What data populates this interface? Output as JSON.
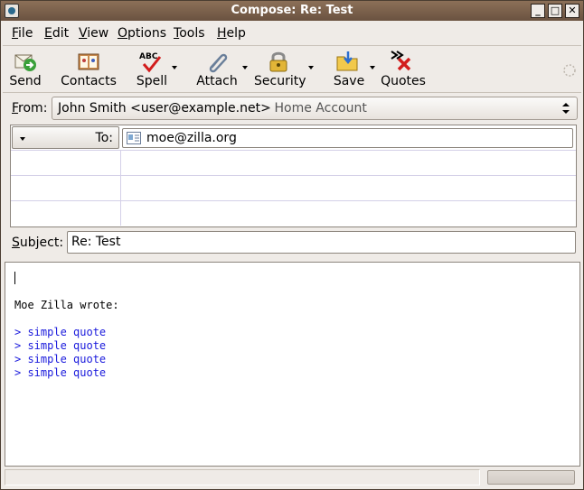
{
  "window": {
    "title": "Compose: Re: Test"
  },
  "menubar": [
    {
      "label": "File",
      "accel": "F",
      "rest": "ile"
    },
    {
      "label": "Edit",
      "accel": "E",
      "rest": "dit"
    },
    {
      "label": "View",
      "accel": "V",
      "rest": "iew"
    },
    {
      "label": "Options",
      "accel": "O",
      "rest": "ptions"
    },
    {
      "label": "Tools",
      "accel": "T",
      "rest": "ools"
    },
    {
      "label": "Help",
      "accel": "H",
      "rest": "elp"
    }
  ],
  "toolbar": {
    "send": "Send",
    "contacts": "Contacts",
    "spell": "Spell",
    "attach": "Attach",
    "security": "Security",
    "save": "Save",
    "quotes": "Quotes"
  },
  "from": {
    "label_accel": "F",
    "label_rest": "rom:",
    "identity": "John Smith <user@example.net>",
    "account": "- Home Account"
  },
  "recipients": [
    {
      "type": "To:",
      "address": "moe@zilla.org"
    }
  ],
  "subject": {
    "label_accel": "S",
    "label_rest": "ubject:",
    "value": "Re: Test"
  },
  "body": {
    "attribution": "Moe Zilla wrote:",
    "quotes": [
      "> simple quote",
      "> simple quote",
      "> simple quote",
      "> simple quote"
    ]
  },
  "colors": {
    "titlebar": "#7a614b",
    "quote_text": "#1a1adc",
    "window_bg": "#efebe7"
  }
}
